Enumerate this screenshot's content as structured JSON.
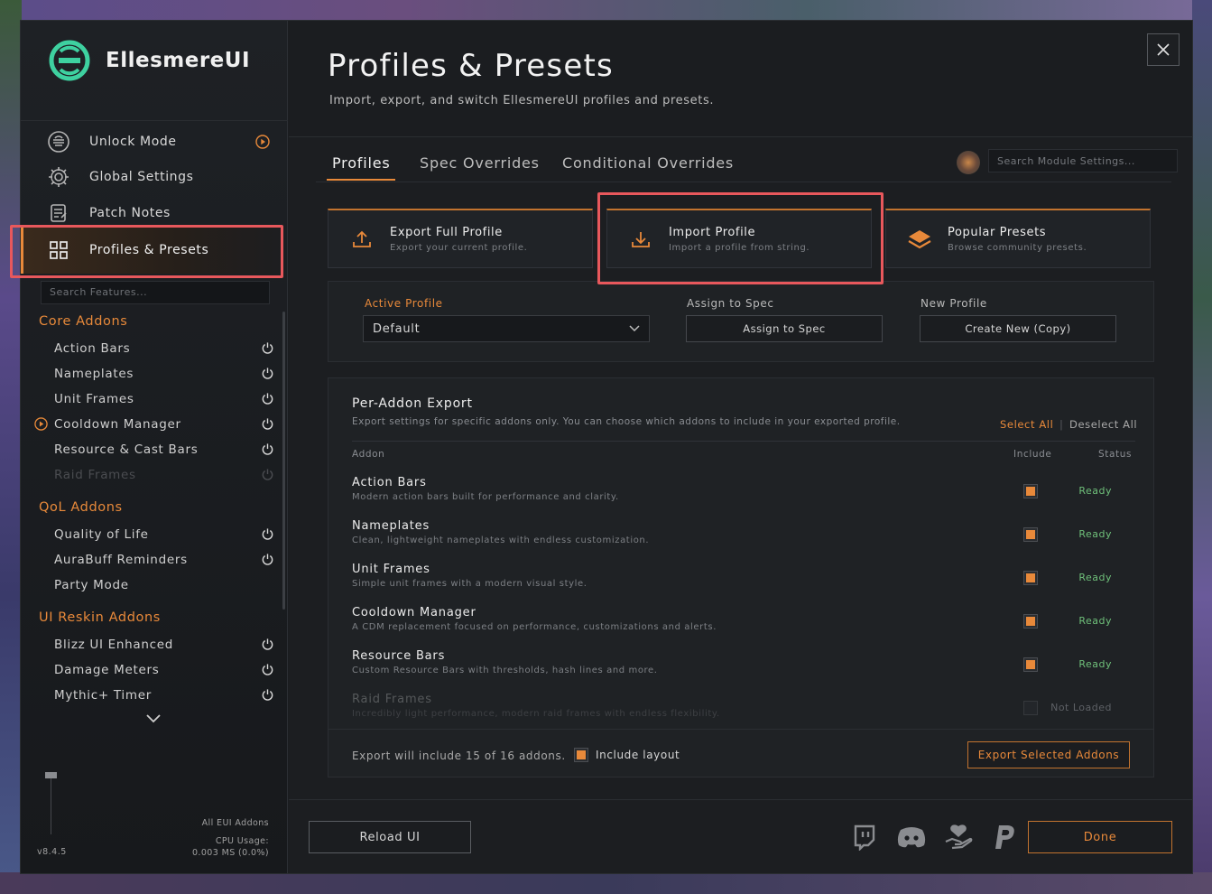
{
  "app": {
    "name": "EllesmereUI",
    "version": "v8.4.5"
  },
  "colors": {
    "accent": "#e8893a",
    "ready": "#6fc07a",
    "highlight": "#e8585c",
    "logo": "#3ed1a0"
  },
  "sidebar": {
    "nav": [
      {
        "label": "Unlock Mode",
        "icon": "unlock-mode-icon"
      },
      {
        "label": "Global Settings",
        "icon": "gear-icon"
      },
      {
        "label": "Patch Notes",
        "icon": "notes-icon"
      },
      {
        "label": "Profiles & Presets",
        "icon": "grid-icon",
        "active": true
      }
    ],
    "search_placeholder": "Search Features...",
    "sections": [
      {
        "title": "Core Addons",
        "items": [
          "Action Bars",
          "Nameplates",
          "Unit Frames",
          "Cooldown Manager",
          "Resource & Cast Bars",
          "Raid Frames"
        ]
      },
      {
        "title": "QoL Addons",
        "items": [
          "Quality of Life",
          "AuraBuff Reminders",
          "Party Mode"
        ]
      },
      {
        "title": "UI Reskin Addons",
        "items": [
          "Blizz UI Enhanced",
          "Damage Meters",
          "Mythic+ Timer"
        ]
      }
    ],
    "cpu": {
      "line1": "All EUI Addons",
      "line2": "CPU Usage:",
      "line3": "0.003 MS (0.0%)"
    }
  },
  "header": {
    "title": "Profiles & Presets",
    "subtitle": "Import, export, and switch EllesmereUI profiles and presets."
  },
  "tabs": [
    {
      "label": "Profiles",
      "active": true
    },
    {
      "label": "Spec Overrides"
    },
    {
      "label": "Conditional Overrides"
    }
  ],
  "module_search_placeholder": "Search Module Settings...",
  "cards": [
    {
      "title": "Export Full Profile",
      "desc": "Export your current profile."
    },
    {
      "title": "Import Profile",
      "desc": "Import a profile from string."
    },
    {
      "title": "Popular Presets",
      "desc": "Browse community presets."
    }
  ],
  "profile": {
    "active_label": "Active Profile",
    "active_value": "Default",
    "assign_label": "Assign to Spec",
    "assign_button": "Assign to Spec",
    "new_label": "New Profile",
    "new_button": "Create New (Copy)"
  },
  "export": {
    "title": "Per-Addon Export",
    "desc": "Export settings for specific addons only. You can choose which addons to include in your exported profile.",
    "select_all": "Select All",
    "separator": "|",
    "deselect_all": "Deselect All",
    "col_addon": "Addon",
    "col_include": "Include",
    "col_status": "Status",
    "rows": [
      {
        "name": "Action Bars",
        "desc": "Modern action bars built for performance and clarity.",
        "included": true,
        "status": "Ready"
      },
      {
        "name": "Nameplates",
        "desc": "Clean, lightweight nameplates with endless customization.",
        "included": true,
        "status": "Ready"
      },
      {
        "name": "Unit Frames",
        "desc": "Simple unit frames with a modern visual style.",
        "included": true,
        "status": "Ready"
      },
      {
        "name": "Cooldown Manager",
        "desc": "A CDM replacement focused on performance, customizations and alerts.",
        "included": true,
        "status": "Ready"
      },
      {
        "name": "Resource Bars",
        "desc": "Custom Resource Bars with thresholds, hash lines and more.",
        "included": true,
        "status": "Ready"
      },
      {
        "name": "Raid Frames",
        "desc": "Incredibly light performance, modern raid frames with endless flexibility.",
        "included": false,
        "status": "Not Loaded"
      }
    ],
    "count_text": "Export will include 15 of 16 addons.",
    "include_layout": "Include layout",
    "export_button": "Export Selected Addons"
  },
  "footer": {
    "reload_button": "Reload UI",
    "done_button": "Done",
    "socials": [
      "twitch-icon",
      "discord-icon",
      "support-icon",
      "paypal-icon"
    ]
  }
}
